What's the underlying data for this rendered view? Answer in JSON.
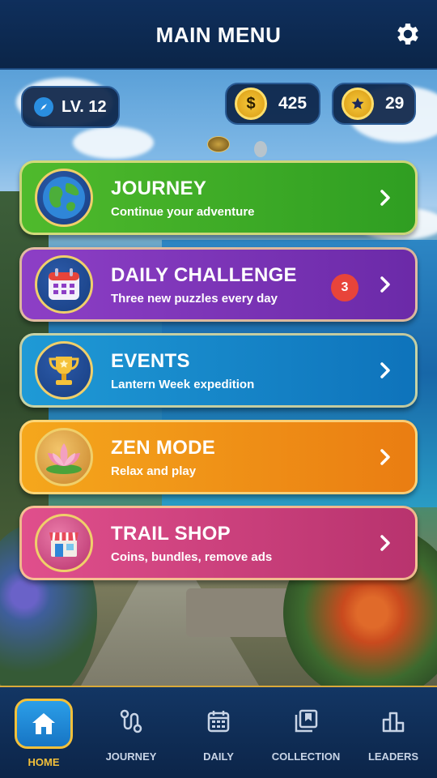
{
  "header": {
    "title": "MAIN MENU",
    "settings_icon": "gear-icon"
  },
  "status": {
    "level": "LV. 12",
    "coins": "425",
    "stars": "29",
    "coin_symbol": "$"
  },
  "menu": [
    {
      "title": "JOURNEY",
      "subtitle": "Continue your adventure",
      "icon": "globe-icon"
    },
    {
      "title": "DAILY CHALLENGE",
      "subtitle": "Three new puzzles every day",
      "icon": "calendar-icon",
      "badge": "3"
    },
    {
      "title": "EVENTS",
      "subtitle": "Lantern Week expedition",
      "icon": "trophy-icon"
    },
    {
      "title": "ZEN MODE",
      "subtitle": "Relax and play",
      "icon": "lotus-icon"
    },
    {
      "title": "TRAIL SHOP",
      "subtitle": "Coins, bundles, remove ads",
      "icon": "shop-icon"
    }
  ],
  "nav": [
    {
      "label": "HOME",
      "icon": "home-icon",
      "active": true
    },
    {
      "label": "JOURNEY",
      "icon": "route-icon"
    },
    {
      "label": "DAILY",
      "icon": "calendar-icon"
    },
    {
      "label": "COLLECTION",
      "icon": "album-icon"
    },
    {
      "label": "LEADERS",
      "icon": "podium-icon"
    }
  ],
  "colors": {
    "accent_gold": "#f3c03a",
    "journey": "#3aa826",
    "daily": "#7a33b6",
    "events": "#1786c8",
    "zen": "#f09518",
    "shop": "#cc417d",
    "badge": "#e8443a"
  }
}
